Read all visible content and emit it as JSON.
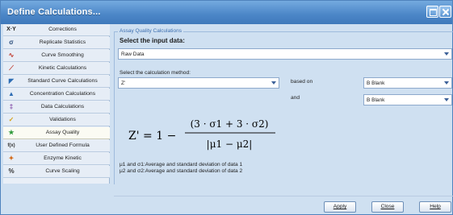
{
  "window": {
    "title": "Define Calculations..."
  },
  "sidebar": {
    "header": {
      "icon_text": "X·Y",
      "label": "Corrections"
    },
    "items": [
      {
        "icon": "sigma-icon",
        "glyph": "σ",
        "color": "#2d4f7d",
        "label": "Replicate Statistics"
      },
      {
        "icon": "curve-smoothing-icon",
        "glyph": "∿",
        "color": "#c0392b",
        "label": "Curve Smoothing"
      },
      {
        "icon": "kinetic-icon",
        "glyph": "⟋",
        "color": "#c0392b",
        "label": "Kinetic Calculations"
      },
      {
        "icon": "standard-curve-icon",
        "glyph": "◤",
        "color": "#2e6db4",
        "label": "Standard Curve Calculations"
      },
      {
        "icon": "concentration-icon",
        "glyph": "▲",
        "color": "#2e6db4",
        "label": "Concentration Calculations"
      },
      {
        "icon": "data-calc-icon",
        "glyph": "‡",
        "color": "#7b3fa0",
        "label": "Data Calculations"
      },
      {
        "icon": "validation-icon",
        "glyph": "✓",
        "color": "#d4a017",
        "label": "Validations"
      },
      {
        "icon": "star-icon",
        "glyph": "★",
        "color": "#2f9a3b",
        "label": "Assay Quality"
      },
      {
        "icon": "formula-icon",
        "glyph": "f(x)",
        "color": "#333333",
        "label": "User Defined Formula"
      },
      {
        "icon": "enzyme-icon",
        "glyph": "✦",
        "color": "#d46a1a",
        "label": "Enzyme Kinetic"
      },
      {
        "icon": "percent-icon",
        "glyph": "%",
        "color": "#333333",
        "label": "Curve Scaling"
      }
    ]
  },
  "main": {
    "group_title": "Assay Quality Calculations",
    "input_label": "Select the input data:",
    "input_value": "Raw Data",
    "method_label": "Select the calculation method:",
    "method_value": "Z'",
    "based_on_label": "based on",
    "based_on_value": "B Blank",
    "and_label": "and",
    "and_value": "B Blank",
    "formula": {
      "lhs": "Z' = 1 −",
      "numerator": "(3 · σ1 + 3 · σ2)",
      "denominator": "|μ1 − μ2|"
    },
    "note1": "μ1 and σ1:Average and standard deviation of data 1",
    "note2": "μ2 and σ2:Average and standard deviation of data 2"
  },
  "footer": {
    "apply": "Apply",
    "close": "Close",
    "help": "Help"
  },
  "colors": {
    "title_bar": "#4b86c7",
    "accent": "#3d6fb0",
    "window_bg": "#cfe0f1"
  }
}
